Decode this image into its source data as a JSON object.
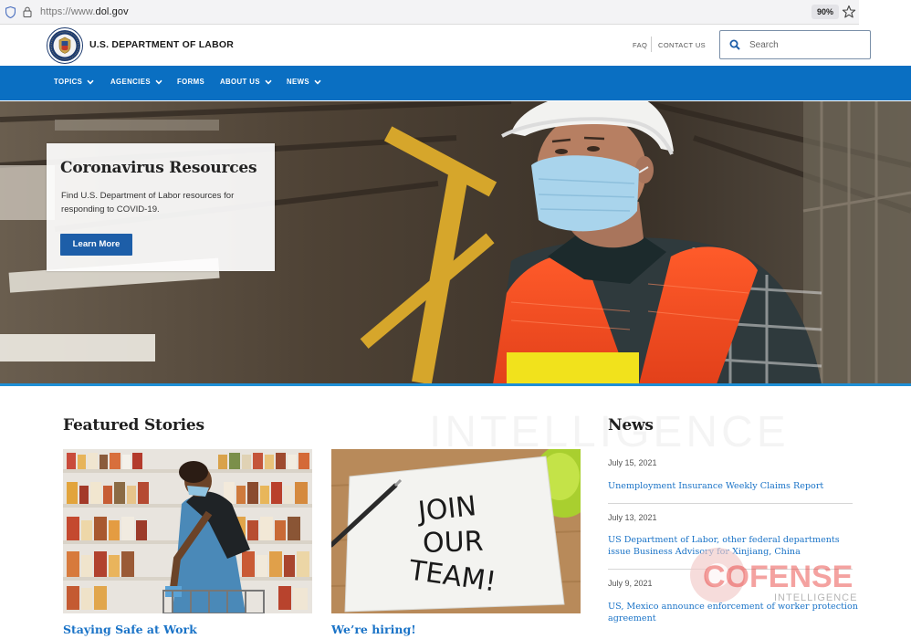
{
  "browser": {
    "url_scheme": "https://www.",
    "url_domain": "dol.gov",
    "zoom": "90%"
  },
  "header": {
    "agency_name": "U.S. DEPARTMENT OF LABOR",
    "faq": "FAQ",
    "contact": "CONTACT US",
    "search_placeholder": "Search"
  },
  "nav": {
    "items": [
      {
        "label": "TOPICS",
        "dropdown": true
      },
      {
        "label": "AGENCIES",
        "dropdown": true
      },
      {
        "label": "FORMS",
        "dropdown": false
      },
      {
        "label": "ABOUT US",
        "dropdown": true
      },
      {
        "label": "NEWS",
        "dropdown": true
      }
    ]
  },
  "hero": {
    "title": "Coronavirus Resources",
    "description": "Find U.S. Department of Labor resources for responding to COVID-19.",
    "button": "Learn More"
  },
  "featured": {
    "title": "Featured Stories",
    "stories": [
      {
        "title": "Staying Safe at Work"
      },
      {
        "title": "We’re hiring!",
        "image_text": [
          "JOIN",
          "OUR",
          "TEAM!"
        ]
      }
    ]
  },
  "news": {
    "title": "News",
    "items": [
      {
        "date": "July 15, 2021",
        "headline": "Unemployment Insurance Weekly Claims Report"
      },
      {
        "date": "July 13, 2021",
        "headline": "US Department of Labor, other federal departments issue Business Advisory for Xinjiang, China"
      },
      {
        "date": "July 9, 2021",
        "headline": "US, Mexico announce enforcement of worker protection agreement"
      }
    ]
  },
  "watermarks": {
    "background": "INTELLIGENCE",
    "brand": "COFENSE",
    "brand_sub": "INTELLIGENCE"
  },
  "colors": {
    "nav_blue": "#0a6fc2",
    "link_blue": "#1a73c7",
    "button_blue": "#1d5ea8",
    "cofense_red": "#e8322f"
  }
}
